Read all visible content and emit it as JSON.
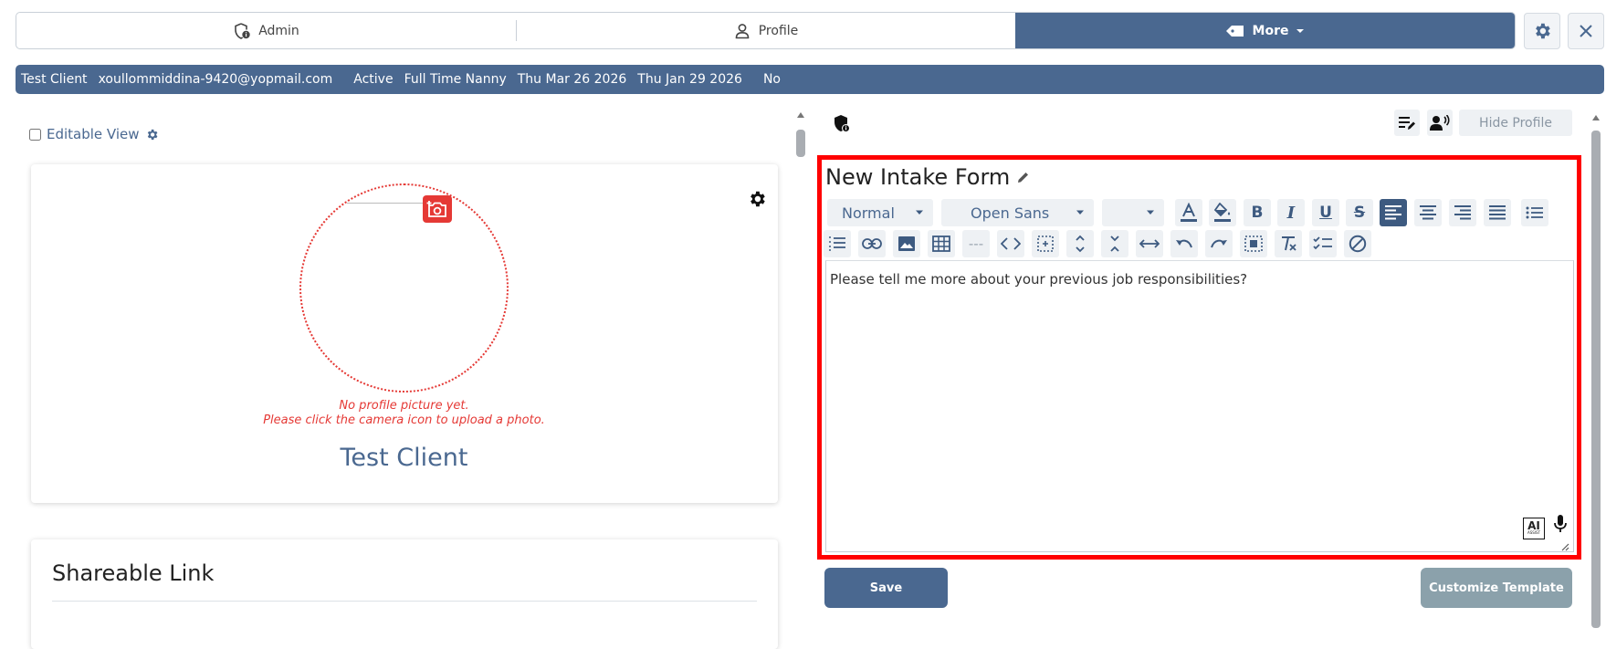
{
  "tabs": [
    {
      "label": "Admin",
      "icon": "shield-info-icon"
    },
    {
      "label": "Profile",
      "icon": "person-icon"
    },
    {
      "label": "More",
      "icon": "tag-icon",
      "active": true
    }
  ],
  "info_bar": {
    "name": "Test Client",
    "email": "xoullommiddina-9420@yopmail.com",
    "status": "Active",
    "role": "Full Time Nanny",
    "date1": "Thu Mar 26 2026",
    "date2": "Thu Jan 29 2026",
    "flag": "No"
  },
  "left": {
    "editable_label": "Editable View",
    "no_picture_line1": "No profile picture yet.",
    "no_picture_line2": "Please click the camera icon to upload a photo.",
    "client_name": "Test Client",
    "share_title": "Shareable Link"
  },
  "right": {
    "hide_profile": "Hide Profile",
    "form_title": "New Intake Form",
    "style_select": "Normal",
    "font_select": "Open Sans",
    "content_text": "Please tell me more about your previous job responsibilities?",
    "ai_badge_line1": "AI",
    "ai_badge_line2": "ASSIST",
    "save_label": "Save",
    "customize_label": "Customize Template"
  },
  "colors": {
    "brand": "#4a6890",
    "danger": "#e53935",
    "highlight": "#ff0000",
    "muted_button": "#8ba1ab"
  }
}
